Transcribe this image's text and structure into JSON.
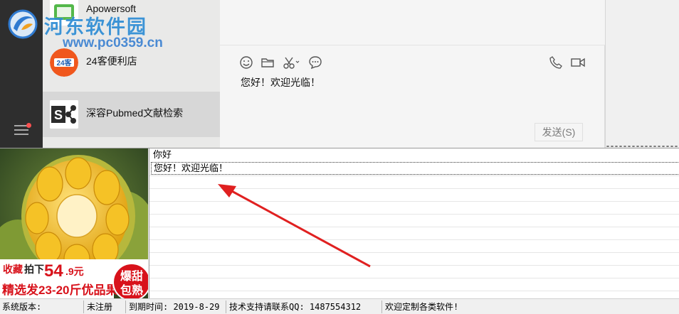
{
  "watermark": {
    "title": "河东软件园",
    "url": "www.pc0359.cn"
  },
  "conversations": [
    {
      "name": "Apowersoft",
      "icon": "apowersoft-logo-icon"
    },
    {
      "name": "24客便利店",
      "icon": "store-24-logo-icon",
      "logo_text": "24客"
    },
    {
      "name": "深容Pubmed文献检索",
      "icon": "share-s-logo-icon"
    }
  ],
  "toolbar": {
    "icons": [
      "emoji-icon",
      "folder-icon",
      "scissors-icon",
      "chat-bubble-icon",
      "phone-icon",
      "video-icon"
    ]
  },
  "composer": {
    "text": "您好！欢迎光临！",
    "send_label": "发送(S)"
  },
  "ad": {
    "line1_prefix": "收藏",
    "line1_mid": "拍下",
    "price_big": "54",
    "price_small": ".9元",
    "line2": "精选发23-20斤优品果",
    "badge_top": "爆甜",
    "badge_bottom": "包熟"
  },
  "messages": [
    "你好",
    "您好！欢迎光临！"
  ],
  "statusbar": {
    "version": "系统版本:",
    "registration": "未注册",
    "expiry": "到期时间: 2019-8-29",
    "support": "技术支持请联系QQ: 1487554312",
    "welcome": "欢迎定制各类软件!"
  },
  "colors": {
    "arrow": "#e02020",
    "ad_red": "#d8121b",
    "watermark_blue": "#2a8ad3"
  }
}
